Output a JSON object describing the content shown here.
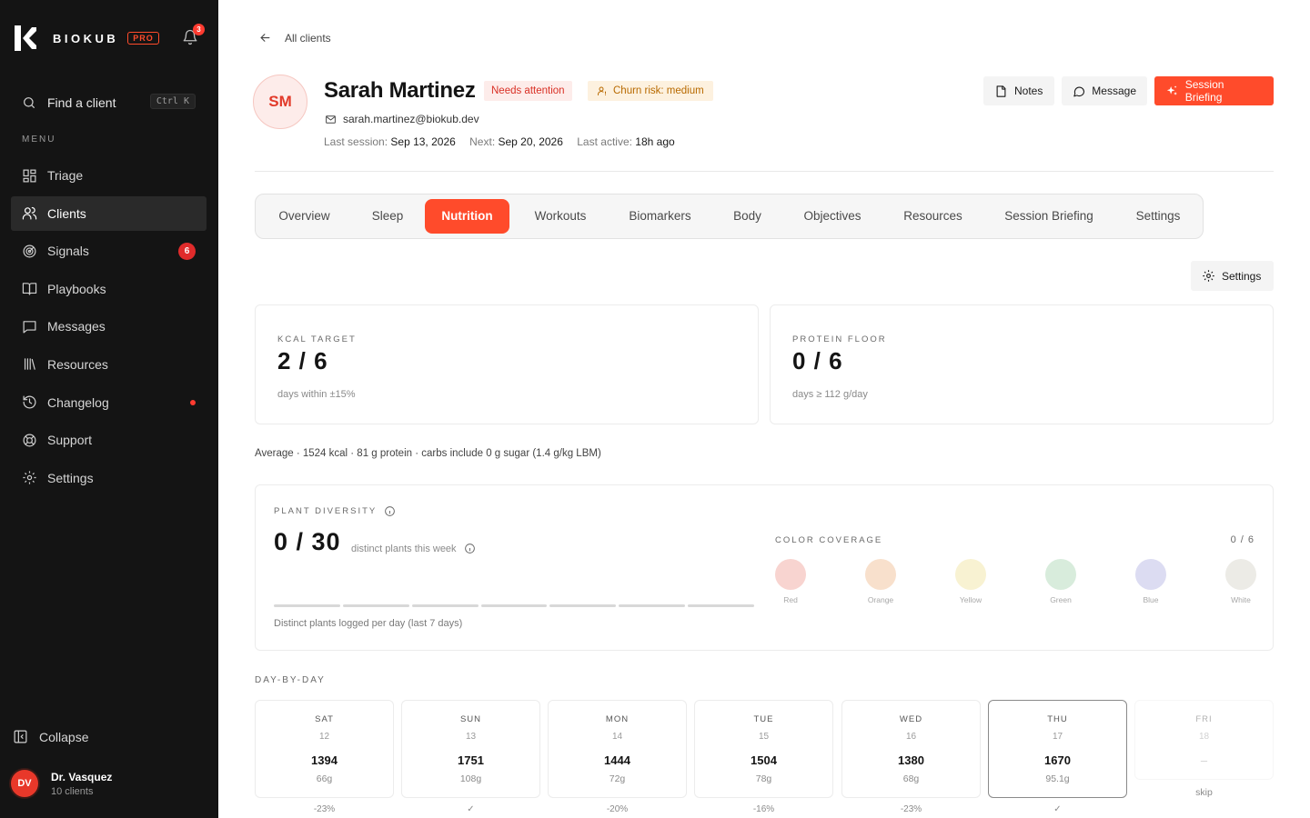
{
  "app": {
    "brand": "BIOKUB",
    "pro_badge": "PRO",
    "notification_count": "3"
  },
  "sidebar": {
    "find_label": "Find a client",
    "find_shortcut": "Ctrl K",
    "menu_caption": "MENU",
    "items": [
      {
        "label": "Triage",
        "icon": "grid-icon"
      },
      {
        "label": "Clients",
        "icon": "users-icon",
        "active": true
      },
      {
        "label": "Signals",
        "icon": "radar-icon",
        "badge": "6"
      },
      {
        "label": "Playbooks",
        "icon": "book-icon"
      },
      {
        "label": "Messages",
        "icon": "message-square-icon"
      },
      {
        "label": "Resources",
        "icon": "library-icon"
      },
      {
        "label": "Changelog",
        "icon": "history-icon",
        "dot": true
      },
      {
        "label": "Support",
        "icon": "lifebuoy-icon"
      },
      {
        "label": "Settings",
        "icon": "gear-icon"
      }
    ],
    "collapse_label": "Collapse",
    "user": {
      "initials": "DV",
      "name": "Dr. Vasquez",
      "sub": "10 clients"
    }
  },
  "header": {
    "back_label": "All clients",
    "initials": "SM",
    "name": "Sarah Martinez",
    "tag_attention": "Needs attention",
    "tag_churn": "Churn risk: medium",
    "email": "sarah.martinez@biokub.dev",
    "last_session_label": "Last session:",
    "last_session": "Sep 13, 2026",
    "next_label": "Next:",
    "next": "Sep 20, 2026",
    "last_active_label": "Last active:",
    "last_active": "18h ago",
    "notes_label": "Notes",
    "message_label": "Message",
    "briefing_label": "Session Briefing"
  },
  "tabs": [
    {
      "label": "Overview"
    },
    {
      "label": "Sleep"
    },
    {
      "label": "Nutrition",
      "active": true
    },
    {
      "label": "Workouts"
    },
    {
      "label": "Biomarkers"
    },
    {
      "label": "Body"
    },
    {
      "label": "Objectives"
    },
    {
      "label": "Resources"
    },
    {
      "label": "Session Briefing"
    },
    {
      "label": "Settings"
    }
  ],
  "settings_button": "Settings",
  "metrics": {
    "kcal": {
      "caption": "KCAL TARGET",
      "value": "2 / 6",
      "sub": "days within ±15%"
    },
    "protein": {
      "caption": "PROTEIN FLOOR",
      "value": "0 / 6",
      "sub": "days ≥ 112 g/day"
    }
  },
  "average_line": "Average · 1524 kcal · 81 g protein · carbs include 0 g sugar (1.4 g/kg LBM)",
  "plant_diversity": {
    "caption": "PLANT DIVERSITY",
    "value": "0 / 30",
    "desc": "distinct plants this week",
    "footer": "Distinct plants logged per day (last 7 days)",
    "daily_counts": [
      0,
      0,
      0,
      0,
      0,
      0,
      0
    ]
  },
  "color_coverage": {
    "caption": "COLOR COVERAGE",
    "count": "0 / 6",
    "colors": [
      {
        "name": "Red",
        "hex": "#f8d4d0"
      },
      {
        "name": "Orange",
        "hex": "#f8e0cc"
      },
      {
        "name": "Yellow",
        "hex": "#f8f2d2"
      },
      {
        "name": "Green",
        "hex": "#d8ecdc"
      },
      {
        "name": "Blue",
        "hex": "#dcdcf2"
      },
      {
        "name": "White",
        "hex": "#ecebe6"
      }
    ]
  },
  "day_by_day": {
    "caption": "DAY-BY-DAY",
    "days": [
      {
        "dow": "SAT",
        "date": "12",
        "kcal": "1394",
        "protein": "66g",
        "delta": "-23%"
      },
      {
        "dow": "SUN",
        "date": "13",
        "kcal": "1751",
        "protein": "108g",
        "delta": "✓"
      },
      {
        "dow": "MON",
        "date": "14",
        "kcal": "1444",
        "protein": "72g",
        "delta": "-20%"
      },
      {
        "dow": "TUE",
        "date": "15",
        "kcal": "1504",
        "protein": "78g",
        "delta": "-16%"
      },
      {
        "dow": "WED",
        "date": "16",
        "kcal": "1380",
        "protein": "68g",
        "delta": "-23%"
      },
      {
        "dow": "THU",
        "date": "17",
        "kcal": "1670",
        "protein": "95.1g",
        "delta": "✓",
        "selected": true
      },
      {
        "dow": "FRI",
        "date": "18",
        "kcal": "–",
        "protein": "",
        "delta": "skip",
        "skip": true
      }
    ]
  },
  "colors": {
    "accent": "#ff4b2b",
    "sidebar_bg": "#141414",
    "danger": "#d93025",
    "warning": "#b86a00"
  }
}
